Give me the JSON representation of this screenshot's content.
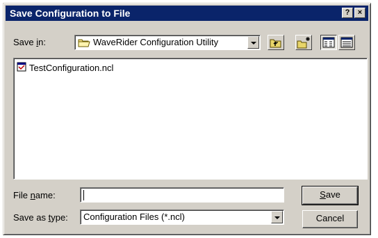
{
  "dialog": {
    "title": "Save Configuration to File",
    "help_button": "?",
    "close_button": "×"
  },
  "save_in": {
    "label_prefix": "Save ",
    "label_accel": "i",
    "label_suffix": "n:",
    "value": "WaveRider Configuration Utility"
  },
  "toolbar": {
    "items": [
      "up-one-level-icon",
      "create-new-folder-icon",
      "list-view-icon",
      "details-view-icon"
    ]
  },
  "files": [
    {
      "name": "TestConfiguration.ncl",
      "icon": "ncl-file-icon"
    }
  ],
  "file_name": {
    "label_prefix": "File ",
    "label_accel": "n",
    "label_suffix": "ame:",
    "value": ""
  },
  "save_as_type": {
    "label_prefix": "Save as ",
    "label_accel": "t",
    "label_suffix": "ype:",
    "value": "Configuration Files (*.ncl)"
  },
  "buttons": {
    "save_accel": "S",
    "save_rest": "ave",
    "cancel": "Cancel"
  },
  "colors": {
    "title_bar": "#0a246a",
    "dialog_face": "#d4d0c8"
  }
}
